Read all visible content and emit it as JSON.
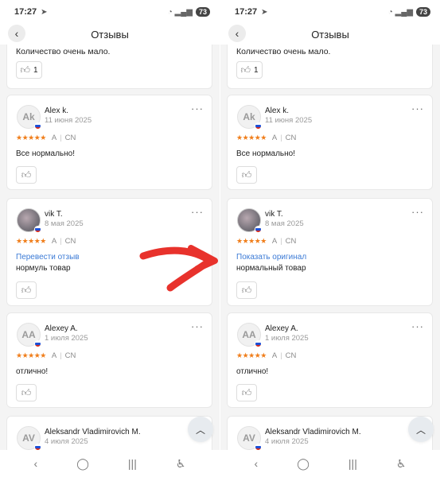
{
  "status": {
    "time": "17:27",
    "battery": "73"
  },
  "page": {
    "title": "Отзывы"
  },
  "partial_review": {
    "text": "Количество очень мало.",
    "likes": "1"
  },
  "left_reviews": [
    {
      "initials": "Ak",
      "author": "Alex k.",
      "date": "11 июня 2025",
      "stars": "★★★★★",
      "variant": "A",
      "origin": "CN",
      "body": "Все нормально!"
    },
    {
      "initials": "",
      "author": "vik T.",
      "date": "8 мая 2025",
      "stars": "★★★★★",
      "variant": "A",
      "origin": "CN",
      "link": "Перевести отзыв",
      "body": "нормуль товар"
    },
    {
      "initials": "AA",
      "author": "Alexey A.",
      "date": "1 июля 2025",
      "stars": "★★★★★",
      "variant": "A",
      "origin": "CN",
      "body": "отлично!"
    },
    {
      "initials": "AV",
      "author": "Aleksandr Vladimirovich M.",
      "date": "4 июля 2025"
    }
  ],
  "right_reviews": [
    {
      "initials": "Ak",
      "author": "Alex k.",
      "date": "11 июня 2025",
      "stars": "★★★★★",
      "variant": "A",
      "origin": "CN",
      "body": "Все нормально!"
    },
    {
      "initials": "",
      "author": "vik T.",
      "date": "8 мая 2025",
      "stars": "★★★★★",
      "variant": "A",
      "origin": "CN",
      "link": "Показать оригинал",
      "body": "нормальный товар"
    },
    {
      "initials": "AA",
      "author": "Alexey A.",
      "date": "1 июля 2025",
      "stars": "★★★★★",
      "variant": "A",
      "origin": "CN",
      "body": "отлично!"
    },
    {
      "initials": "AV",
      "author": "Aleksandr Vladimirovich M.",
      "date": "4 июля 2025"
    }
  ],
  "colors": {
    "star": "#f07e1b",
    "link": "#3c7bd6",
    "annotation_arrow": "#e8322c"
  },
  "icons": [
    "back-arrow-icon",
    "thumbs-up-icon",
    "more-dots-icon",
    "chevron-up-icon",
    "nav-back-icon",
    "nav-home-icon",
    "nav-recents-icon",
    "accessibility-icon",
    "russia-flag-icon"
  ]
}
